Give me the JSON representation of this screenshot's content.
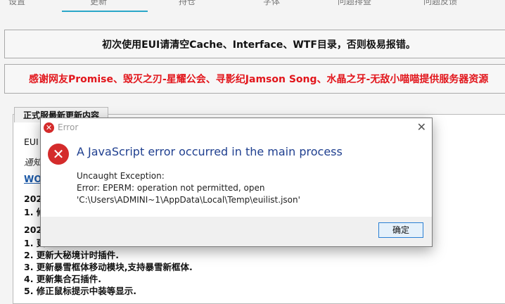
{
  "top_tabs": [
    "设置",
    "更新",
    "持仓",
    "字体",
    "问题排查",
    "问题反馈"
  ],
  "notice_banner": "初次使用EUI请清空Cache、Interface、WTF目录，否则极易报错。",
  "thanks_banner": "感谢网友Promise、毁灭之刃-星耀公会、寻影纪Jamson Song、水晶之牙-无敌小喵喵提供服务器资源",
  "panel": {
    "tab_label": "正式服最新更新内容",
    "lines": [
      {
        "text": "EUI",
        "style": "normal"
      },
      {
        "text": "通知",
        "style": "italic"
      },
      {
        "text": "WO",
        "style": "link"
      },
      {
        "text": "202",
        "style": "bold"
      },
      {
        "text": "1. 修",
        "style": "bold"
      },
      {
        "text": "202",
        "style": "bold"
      },
      {
        "text": "1. 更",
        "style": "bold"
      },
      {
        "text": "2. 更新大秘境计时插件.",
        "style": "bold"
      },
      {
        "text": "3. 更新暴雪框体移动模块,支持暴雪新框体.",
        "style": "bold"
      },
      {
        "text": "4. 更新集合石插件.",
        "style": "bold"
      },
      {
        "text": "5. 修正鼠标提示中装等显示.",
        "style": "bold"
      }
    ]
  },
  "dialog": {
    "title": "Error",
    "heading": "A JavaScript error occurred in the main process",
    "details": [
      "Uncaught Exception:",
      "Error: EPERM: operation not permitted, open",
      "'C:\\Users\\ADMINI~1\\AppData\\Local\\Temp\\euilist.json'"
    ],
    "ok_label": "确定",
    "close_glyph": "✕",
    "icon_glyph": "✕"
  }
}
